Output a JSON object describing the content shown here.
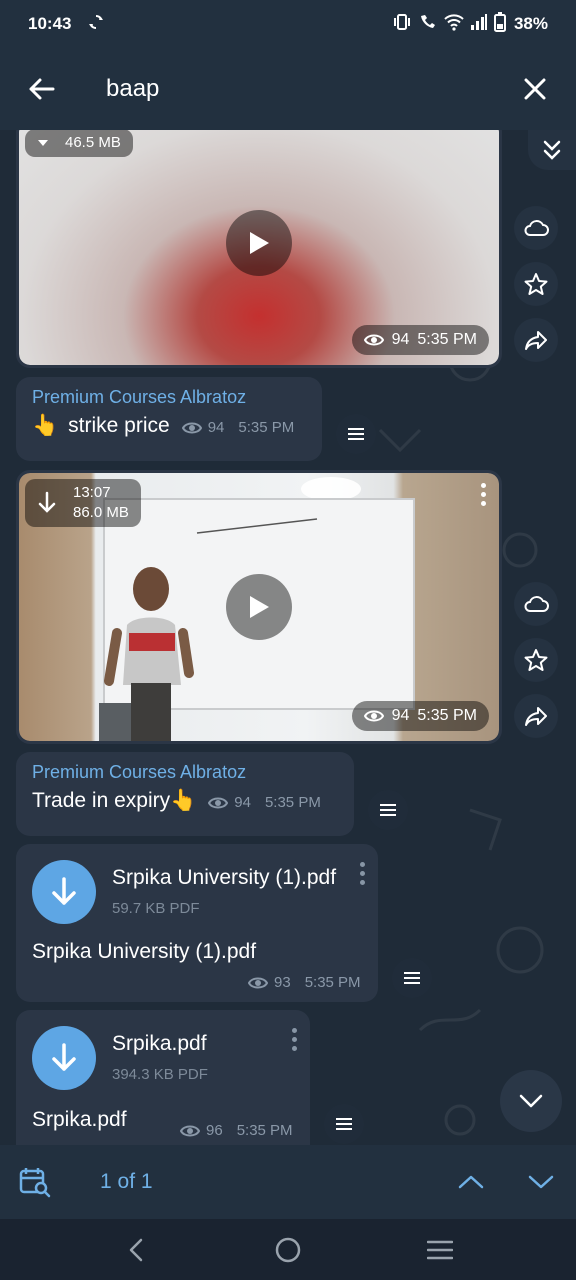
{
  "status_bar": {
    "time": "10:43",
    "battery": "38%"
  },
  "header": {
    "search_query": "baap"
  },
  "messages": {
    "video1": {
      "size": "46.5 MB",
      "views": "94",
      "time": "5:35 PM"
    },
    "text1": {
      "sender": "Premium Courses Albratoz",
      "emoji": "👆",
      "text": "strike price",
      "views": "94",
      "time": "5:35 PM"
    },
    "video2": {
      "duration": "13:07",
      "size": "86.0 MB",
      "views": "94",
      "time": "5:35 PM"
    },
    "text2": {
      "sender": "Premium Courses Albratoz",
      "text": "Trade in expiry👆",
      "views": "94",
      "time": "5:35 PM"
    },
    "file1": {
      "name": "Srpika University (1).pdf",
      "size": "59.7 KB PDF",
      "caption": "Srpika University (1).pdf",
      "views": "93",
      "time": "5:35 PM"
    },
    "file2": {
      "name": "Srpika.pdf",
      "size": "394.3 KB PDF",
      "caption": "Srpika.pdf",
      "views": "96",
      "time": "5:35 PM"
    }
  },
  "search_nav": {
    "result_count": "1 of 1"
  },
  "colors": {
    "accent": "#6fb0e6",
    "file_icon": "#5ea6e4",
    "bubble": "#2b3646",
    "background": "#1f2b38"
  }
}
